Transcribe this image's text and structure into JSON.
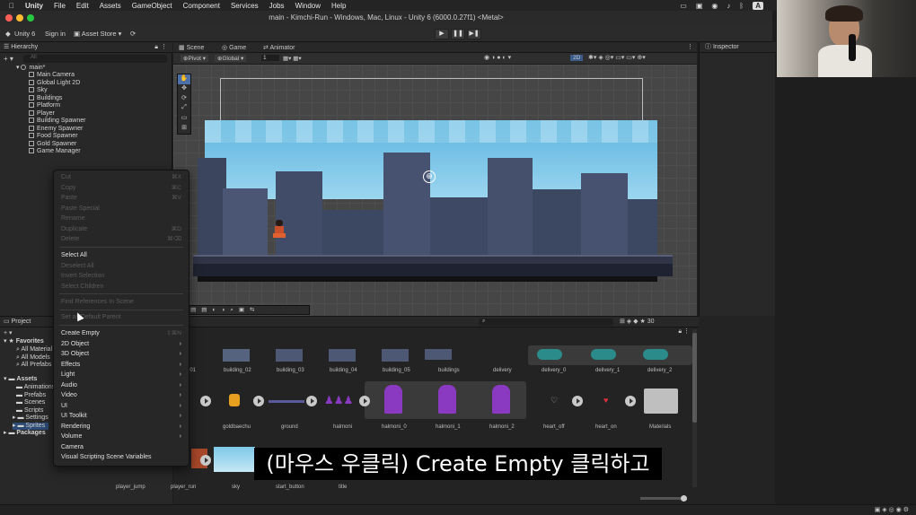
{
  "mac_menu": {
    "app": "Unity",
    "items": [
      "File",
      "Edit",
      "Assets",
      "GameObject",
      "Component",
      "Services",
      "Jobs",
      "Window",
      "Help"
    ],
    "right_badge": "A"
  },
  "window": {
    "title": "main - Kimchi-Run - Windows, Mac, Linux - Unity 6 (6000.0.27f1) <Metal>"
  },
  "toolbar": {
    "account": "Unity 6",
    "sign_in": "Sign in",
    "asset_store": "Asset Store",
    "play": "▶",
    "pause": "❚❚",
    "step": "▶❚"
  },
  "hierarchy": {
    "tab": "Hierarchy",
    "search_placeholder": "All",
    "scene_name": "main*",
    "items": [
      "Main Camera",
      "Global Light 2D",
      "Sky",
      "Buildings",
      "Platform",
      "Player",
      "Building Spawner",
      "Enemy Spawner",
      "Food Spawner",
      "Gold Spawner",
      "Game Manager"
    ]
  },
  "scene_view": {
    "tabs": [
      "Scene",
      "Game",
      "Animator"
    ],
    "pivot": "Pivot",
    "global": "Global",
    "grid_value": "1",
    "mode_2d": "2D"
  },
  "inspector": {
    "tab": "Inspector"
  },
  "context_menu": {
    "items": [
      {
        "label": "Cut",
        "shortcut": "⌘X",
        "enabled": false
      },
      {
        "label": "Copy",
        "shortcut": "⌘C",
        "enabled": false
      },
      {
        "label": "Paste",
        "shortcut": "⌘V",
        "enabled": false
      },
      {
        "label": "Paste Special",
        "shortcut": "",
        "enabled": false
      },
      {
        "label": "Rename",
        "shortcut": "",
        "enabled": false
      },
      {
        "label": "Duplicate",
        "shortcut": "⌘D",
        "enabled": false
      },
      {
        "label": "Delete",
        "shortcut": "⌘⌫",
        "enabled": false
      },
      {
        "label": "Select All",
        "shortcut": "",
        "enabled": true
      },
      {
        "label": "Deselect All",
        "shortcut": "",
        "enabled": false
      },
      {
        "label": "Invert Selection",
        "shortcut": "",
        "enabled": false
      },
      {
        "label": "Select Children",
        "shortcut": "",
        "enabled": false
      },
      {
        "label": "Find References In Scene",
        "shortcut": "",
        "enabled": false
      },
      {
        "label": "Set as Default Parent",
        "shortcut": "",
        "enabled": false
      },
      {
        "label": "Create Empty",
        "shortcut": "⇧⌘N",
        "enabled": true
      },
      {
        "label": "2D Object",
        "submenu": true,
        "enabled": true
      },
      {
        "label": "3D Object",
        "submenu": true,
        "enabled": true
      },
      {
        "label": "Effects",
        "submenu": true,
        "enabled": true
      },
      {
        "label": "Light",
        "submenu": true,
        "enabled": true
      },
      {
        "label": "Audio",
        "submenu": true,
        "enabled": true
      },
      {
        "label": "Video",
        "submenu": true,
        "enabled": true
      },
      {
        "label": "UI",
        "submenu": true,
        "enabled": true
      },
      {
        "label": "UI Toolkit",
        "submenu": true,
        "enabled": true
      },
      {
        "label": "Rendering",
        "submenu": true,
        "enabled": true
      },
      {
        "label": "Volume",
        "submenu": true,
        "enabled": true
      },
      {
        "label": "Camera",
        "submenu": false,
        "enabled": true
      },
      {
        "label": "Visual Scripting Scene Variables",
        "submenu": false,
        "enabled": true
      }
    ]
  },
  "project": {
    "tab": "Project",
    "favorites": "Favorites",
    "fav_items": [
      "All Material",
      "All Models",
      "All Prefabs"
    ],
    "assets": "Assets",
    "asset_folders": [
      "Animations",
      "Prefabs",
      "Scenes",
      "Scripts",
      "Settings",
      "Sprites"
    ],
    "packages": "Packages",
    "zoom": "30"
  },
  "asset_grid": {
    "row1": [
      "_01",
      "building_02",
      "building_03",
      "building_04",
      "building_05",
      "buildings",
      "delivery",
      "delivery_0",
      "delivery_1",
      "delivery_2"
    ],
    "row2": [
      "goldbaechu",
      "ground",
      "halmoni",
      "halmoni_0",
      "halmoni_1",
      "halmoni_2",
      "heart_off",
      "heart_on",
      "Materials"
    ],
    "row3": [
      "player_jump",
      "player_run",
      "sky",
      "start_button",
      "title"
    ]
  },
  "caption": "(마우스 우클릭) Create Empty 클릭하고",
  "colors": {
    "sky": "#7ec8e8",
    "building": "#3f4a62",
    "menu_bg": "#272727",
    "caption_bg": "#000000"
  }
}
